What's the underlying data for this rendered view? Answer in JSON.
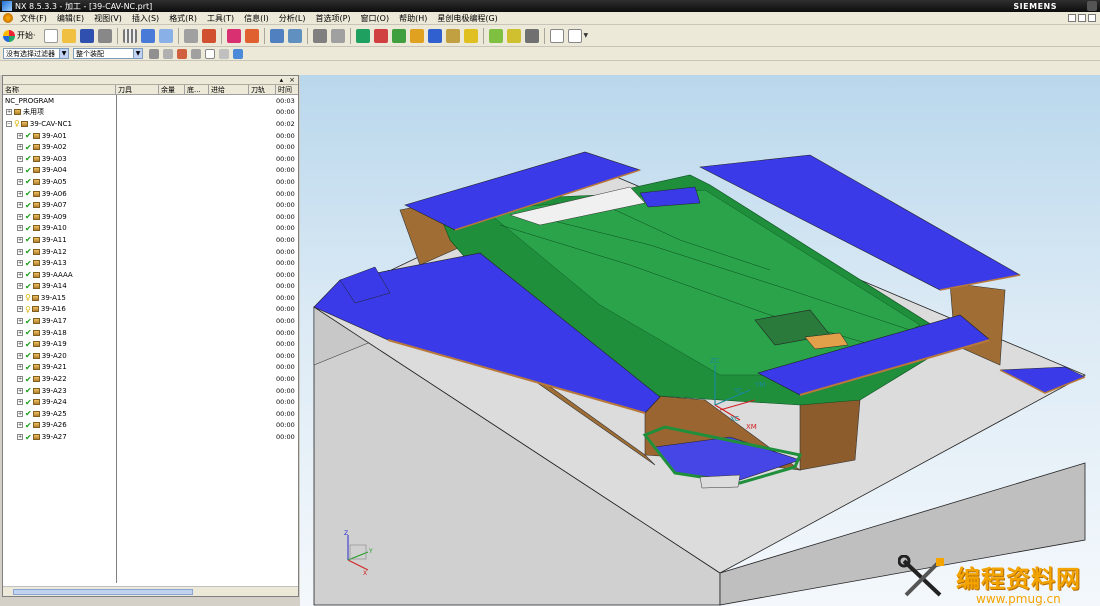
{
  "window": {
    "title": "NX 8.5.3.3 - 加工 - [39-CAV-NC.prt]",
    "brand": "SIEMENS"
  },
  "menu": [
    "文件(F)",
    "编辑(E)",
    "视图(V)",
    "插入(S)",
    "格式(R)",
    "工具(T)",
    "信息(I)",
    "分析(L)",
    "首选项(P)",
    "窗口(O)",
    "帮助(H)",
    "星创电极编程(G)"
  ],
  "toolbar": {
    "start_label": "开始·"
  },
  "filters": {
    "selection_filter": "没有选择过滤器",
    "assembly_scope": "整个装配"
  },
  "navigator": {
    "columns": [
      "名称",
      "刀具",
      "余量",
      "底...",
      "进给",
      "刀轨",
      "时间"
    ],
    "root": {
      "name": "NC_PROGRAM",
      "time": "00:03"
    },
    "unused": {
      "name": "未用项",
      "time": "00:00"
    },
    "group": {
      "name": "39-CAV-NC1",
      "time": "00:02"
    },
    "operations": [
      {
        "name": "39-A01",
        "status": "check",
        "time": "00:00"
      },
      {
        "name": "39-A02",
        "status": "check",
        "time": "00:00"
      },
      {
        "name": "39-A03",
        "status": "check",
        "time": "00:00"
      },
      {
        "name": "39-A04",
        "status": "check",
        "time": "00:00"
      },
      {
        "name": "39-A05",
        "status": "check",
        "time": "00:00"
      },
      {
        "name": "39-A06",
        "status": "check",
        "time": "00:00"
      },
      {
        "name": "39-A07",
        "status": "check",
        "time": "00:00"
      },
      {
        "name": "39-A09",
        "status": "check",
        "time": "00:00"
      },
      {
        "name": "39-A10",
        "status": "check",
        "time": "00:00"
      },
      {
        "name": "39-A11",
        "status": "check",
        "time": "00:00"
      },
      {
        "name": "39-A12",
        "status": "check",
        "time": "00:00"
      },
      {
        "name": "39-A13",
        "status": "check",
        "time": "00:00"
      },
      {
        "name": "39-AAAA",
        "status": "check",
        "time": "00:00"
      },
      {
        "name": "39-A14",
        "status": "check",
        "time": "00:00"
      },
      {
        "name": "39-A15",
        "status": "key",
        "time": "00:00"
      },
      {
        "name": "39-A16",
        "status": "key",
        "time": "00:00"
      },
      {
        "name": "39-A17",
        "status": "check",
        "time": "00:00"
      },
      {
        "name": "39-A18",
        "status": "check",
        "time": "00:00"
      },
      {
        "name": "39-A19",
        "status": "check",
        "time": "00:00"
      },
      {
        "name": "39-A20",
        "status": "check",
        "time": "00:00"
      },
      {
        "name": "39-A21",
        "status": "check",
        "time": "00:00"
      },
      {
        "name": "39-A22",
        "status": "check",
        "time": "00:00"
      },
      {
        "name": "39-A23",
        "status": "check",
        "time": "00:00"
      },
      {
        "name": "39-A24",
        "status": "check",
        "time": "00:00"
      },
      {
        "name": "39-A25",
        "status": "check",
        "time": "00:00"
      },
      {
        "name": "39-A26",
        "status": "check",
        "time": "00:00"
      },
      {
        "name": "39-A27",
        "status": "check",
        "time": "00:00"
      }
    ]
  },
  "viewport": {
    "axis_labels": {
      "xc": "XC",
      "yc": "YC",
      "zc": "ZC",
      "xm": "XM",
      "ym": "YM",
      "x": "X",
      "y": "Y",
      "z": "Z"
    }
  },
  "watermark": {
    "title": "编程资料网",
    "url": "www.pmug.cn"
  },
  "colors": {
    "cavity_green": "#1f8f3c",
    "top_blue": "#3a3ae8",
    "side_gray": "#d2d2d2",
    "wall_bronze": "#9c6a2e",
    "watermark_orange": "#f4a400"
  }
}
